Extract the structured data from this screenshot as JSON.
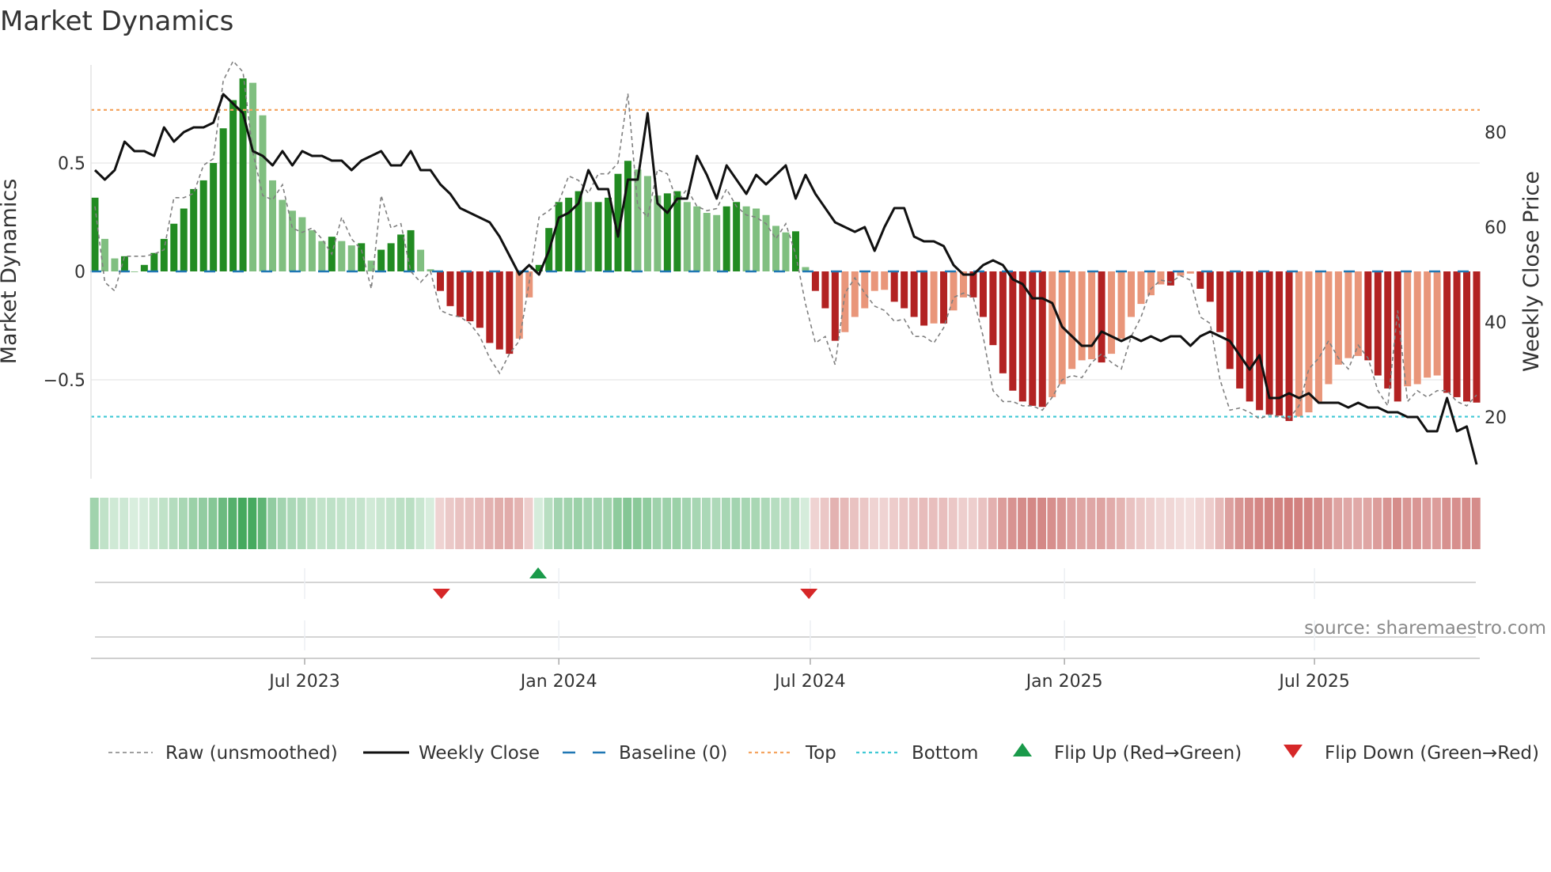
{
  "title": "Market Dynamics",
  "source": "source: sharemaestro.com",
  "chart_data": {
    "type": "bar",
    "title": "Market Dynamics",
    "ylabel": "Market Dynamics",
    "y2label": "Weekly Close Price",
    "ylim": [
      -0.96,
      0.97
    ],
    "y2lim": [
      9,
      96
    ],
    "yticks": [
      {
        "v": 0.5,
        "label": "0.5"
      },
      {
        "v": 0,
        "label": "0"
      },
      {
        "v": -0.5,
        "label": "−0.5"
      }
    ],
    "y2ticks": [
      {
        "v": 80,
        "label": "80"
      },
      {
        "v": 60,
        "label": "60"
      },
      {
        "v": 40,
        "label": "40"
      },
      {
        "v": 20,
        "label": "20"
      }
    ],
    "xticks": [
      {
        "date": "2023-07-01",
        "label": "Jul 2023"
      },
      {
        "date": "2024-01-01",
        "label": "Jan 2024"
      },
      {
        "date": "2024-07-01",
        "label": "Jul 2024"
      },
      {
        "date": "2025-01-01",
        "label": "Jan 2025"
      },
      {
        "date": "2025-07-01",
        "label": "Jul 2025"
      }
    ],
    "grid": true,
    "top_level": 0.745,
    "bottom_level": -0.67,
    "baseline": 0,
    "values": [
      0.34,
      0.15,
      0.06,
      0.07,
      0.0,
      0.03,
      0.085,
      0.15,
      0.22,
      0.29,
      0.38,
      0.42,
      0.5,
      0.66,
      0.79,
      0.89,
      0.87,
      0.72,
      0.42,
      0.33,
      0.28,
      0.25,
      0.19,
      0.14,
      0.16,
      0.14,
      0.12,
      0.13,
      0.05,
      0.1,
      0.13,
      0.17,
      0.19,
      0.1,
      0.01,
      -0.09,
      -0.16,
      -0.21,
      -0.23,
      -0.26,
      -0.33,
      -0.36,
      -0.38,
      -0.31,
      -0.12,
      0.03,
      0.2,
      0.32,
      0.34,
      0.37,
      0.32,
      0.32,
      0.34,
      0.45,
      0.51,
      0.47,
      0.44,
      0.35,
      0.36,
      0.37,
      0.32,
      0.3,
      0.27,
      0.26,
      0.3,
      0.32,
      0.3,
      0.29,
      0.26,
      0.21,
      0.18,
      0.185,
      0.02,
      -0.09,
      -0.17,
      -0.32,
      -0.28,
      -0.21,
      -0.17,
      -0.09,
      -0.085,
      -0.14,
      -0.17,
      -0.21,
      -0.25,
      -0.24,
      -0.24,
      -0.18,
      -0.12,
      -0.12,
      -0.21,
      -0.34,
      -0.47,
      -0.55,
      -0.6,
      -0.62,
      -0.625,
      -0.58,
      -0.52,
      -0.45,
      -0.41,
      -0.405,
      -0.42,
      -0.38,
      -0.31,
      -0.21,
      -0.15,
      -0.11,
      -0.06,
      -0.065,
      -0.02,
      -0.01,
      -0.08,
      -0.14,
      -0.28,
      -0.45,
      -0.54,
      -0.6,
      -0.64,
      -0.66,
      -0.665,
      -0.69,
      -0.67,
      -0.65,
      -0.6,
      -0.52,
      -0.43,
      -0.4,
      -0.39,
      -0.41,
      -0.48,
      -0.54,
      -0.6,
      -0.53,
      -0.52,
      -0.49,
      -0.48,
      -0.56,
      -0.58,
      -0.6,
      -0.605
    ],
    "raw": [
      0.3,
      -0.05,
      -0.09,
      0.07,
      0.07,
      0.07,
      0.08,
      0.1,
      0.34,
      0.34,
      0.36,
      0.49,
      0.52,
      0.88,
      0.97,
      0.92,
      0.55,
      0.35,
      0.33,
      0.4,
      0.2,
      0.18,
      0.2,
      0.15,
      0.08,
      0.25,
      0.15,
      0.1,
      -0.08,
      0.35,
      0.2,
      0.22,
      0.0,
      -0.05,
      0.0,
      -0.18,
      -0.2,
      -0.21,
      -0.24,
      -0.3,
      -0.4,
      -0.47,
      -0.38,
      -0.32,
      -0.05,
      0.25,
      0.28,
      0.32,
      0.44,
      0.42,
      0.36,
      0.45,
      0.45,
      0.5,
      0.82,
      0.3,
      0.25,
      0.47,
      0.45,
      0.32,
      0.38,
      0.3,
      0.28,
      0.29,
      0.38,
      0.3,
      0.26,
      0.25,
      0.22,
      0.15,
      0.22,
      0.08,
      -0.15,
      -0.33,
      -0.3,
      -0.43,
      -0.1,
      -0.03,
      -0.1,
      -0.16,
      -0.18,
      -0.23,
      -0.22,
      -0.3,
      -0.3,
      -0.33,
      -0.26,
      -0.12,
      -0.1,
      -0.12,
      -0.3,
      -0.55,
      -0.6,
      -0.6,
      -0.62,
      -0.62,
      -0.64,
      -0.58,
      -0.5,
      -0.48,
      -0.49,
      -0.42,
      -0.38,
      -0.42,
      -0.45,
      -0.3,
      -0.21,
      -0.08,
      -0.04,
      -0.05,
      -0.02,
      -0.04,
      -0.21,
      -0.24,
      -0.5,
      -0.64,
      -0.63,
      -0.65,
      -0.68,
      -0.66,
      -0.67,
      -0.68,
      -0.62,
      -0.45,
      -0.4,
      -0.32,
      -0.4,
      -0.45,
      -0.34,
      -0.4,
      -0.55,
      -0.62,
      -0.18,
      -0.6,
      -0.55,
      -0.58,
      -0.55,
      -0.55,
      -0.6,
      -0.62,
      -0.57
    ],
    "close": [
      72,
      70,
      72,
      78,
      76,
      76,
      75,
      81,
      78,
      80,
      81,
      81,
      82,
      88,
      86,
      84,
      76,
      75,
      73,
      76,
      73,
      76,
      75,
      75,
      74,
      74,
      72,
      74,
      75,
      76,
      73,
      73,
      76,
      72,
      72,
      69,
      67,
      64,
      63,
      62,
      61,
      58,
      54,
      50,
      52,
      50,
      55,
      62,
      63,
      65,
      72,
      68,
      68,
      58,
      70,
      70,
      84,
      65,
      63,
      66,
      66,
      75,
      71,
      66,
      73,
      70,
      67,
      71,
      69,
      71,
      73,
      66,
      71,
      67,
      64,
      61,
      60,
      59,
      60,
      55,
      60,
      64,
      64,
      58,
      57,
      57,
      56,
      52,
      50,
      50,
      52,
      53,
      52,
      49,
      48,
      45,
      45,
      44,
      39,
      37,
      35,
      35,
      38,
      37,
      36,
      37,
      36,
      37,
      36,
      37,
      37,
      35,
      37,
      38,
      37,
      36,
      33,
      30,
      33,
      24,
      24,
      25,
      24,
      25,
      23,
      23,
      23,
      22,
      23,
      22,
      22,
      21,
      21,
      20,
      20,
      17,
      17,
      24,
      17,
      18,
      10
    ],
    "flips": [
      {
        "date": "2023-10-08",
        "type": "down"
      },
      {
        "date": "2023-12-17",
        "type": "up"
      },
      {
        "date": "2024-06-30",
        "type": "down"
      }
    ],
    "legend_position": "bottom",
    "legend": [
      {
        "key": "raw",
        "label": "Raw (unsmoothed)"
      },
      {
        "key": "close",
        "label": "Weekly Close"
      },
      {
        "key": "baseline",
        "label": "Baseline (0)"
      },
      {
        "key": "top",
        "label": "Top"
      },
      {
        "key": "bottom",
        "label": "Bottom"
      },
      {
        "key": "flip_up",
        "label": "Flip Up (Red→Green)"
      },
      {
        "key": "flip_down",
        "label": "Flip Down (Green→Red)"
      }
    ],
    "colors": {
      "pos_strong": "#228b22",
      "pos_weak": "#80bf80",
      "neg_strong": "#b22222",
      "neg_weak": "#e9967a",
      "strip_pos": "#2e9e4a",
      "strip_neg": "#c0504d",
      "close": "#111111",
      "raw": "#808080",
      "baseline": "#1f77b4",
      "top": "#f4a460",
      "bottom": "#3fc8d4",
      "flip_up": "#1a9a4a",
      "flip_down": "#d62728"
    }
  }
}
